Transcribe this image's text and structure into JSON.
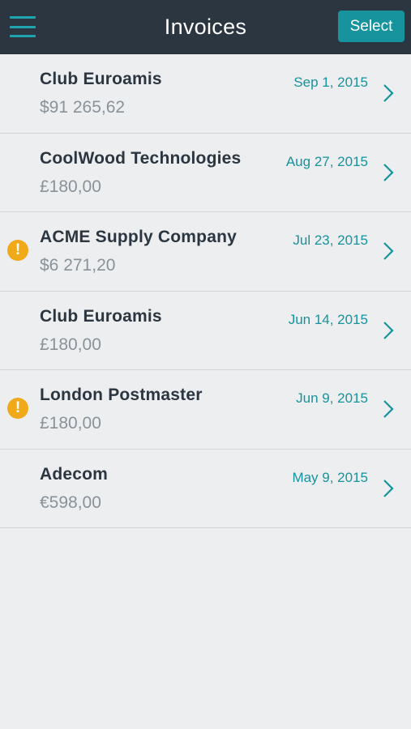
{
  "navbar": {
    "title": "Invoices",
    "select_label": "Select",
    "menu_icon": "menu-icon"
  },
  "colors": {
    "navbar_bg": "#2b3640",
    "accent": "#16939d",
    "warning": "#f0a919",
    "background": "#eceef0"
  },
  "invoices": [
    {
      "company": "Club Euroamis",
      "amount": "$91 265,62",
      "date": "Sep 1, 2015",
      "warning": false
    },
    {
      "company": "CoolWood Technologies",
      "amount": "£180,00",
      "date": "Aug 27, 2015",
      "warning": false
    },
    {
      "company": "ACME Supply Company",
      "amount": "$6 271,20",
      "date": "Jul 23, 2015",
      "warning": true,
      "warning_glyph": "!"
    },
    {
      "company": "Club Euroamis",
      "amount": "£180,00",
      "date": "Jun 14, 2015",
      "warning": false
    },
    {
      "company": "London Postmaster",
      "amount": "£180,00",
      "date": "Jun 9, 2015",
      "warning": true,
      "warning_glyph": "!"
    },
    {
      "company": "Adecom",
      "amount": "€598,00",
      "date": "May 9, 2015",
      "warning": false
    }
  ]
}
